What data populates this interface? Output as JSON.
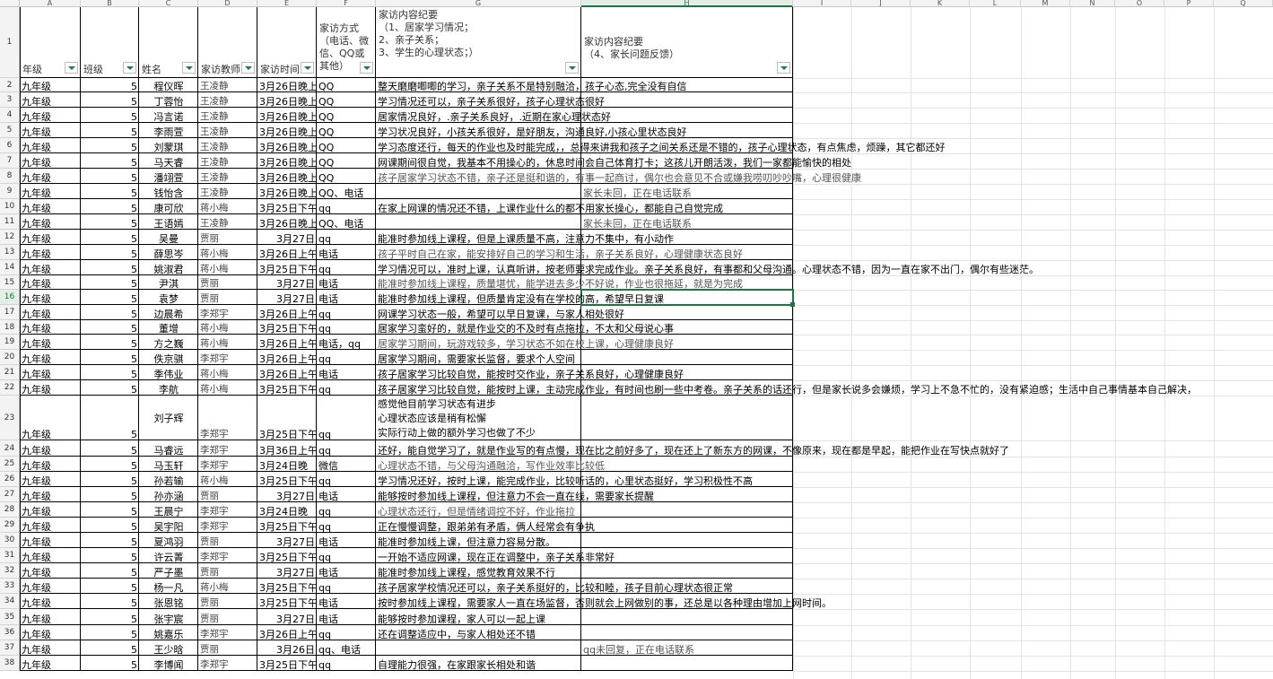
{
  "columns": [
    "A",
    "B",
    "C",
    "D",
    "E",
    "F",
    "G",
    "H",
    "I",
    "J",
    "K",
    "L",
    "M",
    "N",
    "O",
    "P",
    "Q"
  ],
  "selected_cell": "H16",
  "header": {
    "grade": "年级",
    "class": "班级",
    "name": "姓名",
    "teacher": "家访教师",
    "time": "家访时间",
    "method": "家访方式\n（电话、微\n信、QQ或\n其他）",
    "content_g": "家访内容纪要\n（1、居家学习情况；\n2、亲子关系；\n3、学生的心理状态；）",
    "content_h": "家访内容纪要\n（4、家长问题反馈）"
  },
  "rows": [
    {
      "n": "2",
      "grade": "九年级",
      "cls": "5",
      "name": "程仪晖",
      "teacher": "王凌静",
      "time": "3月26日晚上",
      "method": "QQ",
      "g": "整天磨磨唧唧的学习，亲子关系不是特别融洽，孩子心态,完全没有自信",
      "h": ""
    },
    {
      "n": "3",
      "grade": "九年级",
      "cls": "5",
      "name": "丁蓉怡",
      "teacher": "王凌静",
      "time": "3月26日晚上",
      "method": "QQ",
      "g": "学习情况还可以，亲子关系很好，孩子心理状态很好",
      "h": ""
    },
    {
      "n": "4",
      "grade": "九年级",
      "cls": "5",
      "name": "冯言诺",
      "teacher": "王凌静",
      "time": "3月26日晚上",
      "method": "QQ",
      "g": "居家情况良好，.亲子关系良好，.近期在家心理状态好",
      "h": ""
    },
    {
      "n": "5",
      "grade": "九年级",
      "cls": "5",
      "name": "李雨萱",
      "teacher": "王凌静",
      "time": "3月26日晚上",
      "method": "QQ",
      "g": "学习状况良好，小孩关系很好，是好朋友，沟通良好,小孩心里状态良好",
      "h": ""
    },
    {
      "n": "6",
      "grade": "九年级",
      "cls": "5",
      "name": "刘蒙琪",
      "teacher": "王凌静",
      "time": "3月26日晚上",
      "method": "QQ",
      "g": "学习态度还行，每天的作业也及时能完成，，总得来讲我和孩子之间关系还是不错的，孩子心理状态，有点焦虑，烦躁，其它都还好",
      "h": ""
    },
    {
      "n": "7",
      "grade": "九年级",
      "cls": "5",
      "name": "马天睿",
      "teacher": "王凌静",
      "time": "3月26日晚上",
      "method": "QQ",
      "g": "网课期间很自觉，我基本不用操心的，休息时间会自己体育打卡；这孩儿开朗活泼，我们一家都能愉快的相处",
      "h": ""
    },
    {
      "n": "8",
      "grade": "九年级",
      "cls": "5",
      "name": "潘翊萱",
      "teacher": "王凌静",
      "time": "3月26日晚上",
      "method": "QQ",
      "g": "孩子居家学习状态不错，亲子还是挺和谐的，有事一起商讨，偶尔也会意见不合或嫌我唠叨吵吵嘴，心理很健康",
      "h": "",
      "gray": true
    },
    {
      "n": "9",
      "grade": "九年级",
      "cls": "5",
      "name": "钱怡含",
      "teacher": "王凌静",
      "time": "3月26日晚上",
      "method": "QQ、电话",
      "g": "",
      "h": "家长未回，正在电话联系"
    },
    {
      "n": "10",
      "grade": "九年级",
      "cls": "5",
      "name": "康可欣",
      "teacher": "蒋小梅",
      "time": "3月25日下午",
      "method": "qq",
      "g": "在家上网课的情况还不错，上课作业什么的都不用家长操心，都能自己自觉完成",
      "h": ""
    },
    {
      "n": "11",
      "grade": "九年级",
      "cls": "5",
      "name": "王语嫣",
      "teacher": "王凌静",
      "time": "3月26日晚上",
      "method": "QQ、电话",
      "g": "",
      "h": "家长未回，正在电话联系"
    },
    {
      "n": "12",
      "grade": "九年级",
      "cls": "5",
      "name": "吴曼",
      "teacher": "贾丽",
      "time": "3月27日",
      "method": "qq",
      "g": "能准时参加线上课程，但是上课质量不高，注意力不集中，有小动作",
      "h": ""
    },
    {
      "n": "13",
      "grade": "九年级",
      "cls": "5",
      "name": "薛思岑",
      "teacher": "蒋小梅",
      "time": "3月26日上午",
      "method": "电话",
      "g": "孩子平时自己在家，能安排好自己的学习和生活，亲子关系良好，心理健康状态良好",
      "h": "",
      "gray": true
    },
    {
      "n": "14",
      "grade": "九年级",
      "cls": "5",
      "name": "姚淑君",
      "teacher": "蒋小梅",
      "time": "3月25日下午",
      "method": "qq",
      "g": "学习情况可以，准时上课，认真听讲，按老师要求完成作业。亲子关系良好，有事都和父母沟通。心理状态不错，因为一直在家不出门，偶尔有些迷茫。",
      "h": ""
    },
    {
      "n": "15",
      "grade": "九年级",
      "cls": "5",
      "name": "尹淇",
      "teacher": "贾丽",
      "time": "3月27日",
      "method": "电话",
      "g": "能准时参加线上课程，质量堪忧，能学进去多少不好说，作业也很拖延，就是为完成",
      "h": "",
      "gray": true
    },
    {
      "n": "16",
      "grade": "九年级",
      "cls": "5",
      "name": "袁梦",
      "teacher": "贾丽",
      "time": "3月27日",
      "method": "电话",
      "g": "能准时参加线上课程，但质量肯定没有在学校的高，希望早日复课",
      "h": ""
    },
    {
      "n": "17",
      "grade": "九年级",
      "cls": "5",
      "name": "边晨希",
      "teacher": "李郑宇",
      "time": "3月26日上午",
      "method": "qq",
      "g": "网课学习状态一般，希望可以早日复课，与家人相处很好",
      "h": ""
    },
    {
      "n": "18",
      "grade": "九年级",
      "cls": "5",
      "name": "董增",
      "teacher": "蒋小梅",
      "time": "3月25日下午",
      "method": "qq",
      "g": "居家学习蛮好的，就是作业交的不及时有点拖拉，不太和父母说心事",
      "h": ""
    },
    {
      "n": "19",
      "grade": "九年级",
      "cls": "5",
      "name": "方之巍",
      "teacher": "蒋小梅",
      "time": "3月26日上午",
      "method": "电话，qq",
      "g": "居家学习期间，玩游戏较多，学习状态不如在校上课，心理健康良好",
      "h": "",
      "gray": true
    },
    {
      "n": "20",
      "grade": "九年级",
      "cls": "5",
      "name": "佚京骐",
      "teacher": "李郑宇",
      "time": "3月26日上午",
      "method": "qq",
      "g": "居家学习期间，需要家长监督，要求个人空间",
      "h": ""
    },
    {
      "n": "21",
      "grade": "九年级",
      "cls": "5",
      "name": "季伟业",
      "teacher": "蒋小梅",
      "time": "3月26日上午",
      "method": "电话",
      "g": "孩子居家学习比较自觉，能按时交作业，亲子关系良好，心理健康良好",
      "h": ""
    },
    {
      "n": "22",
      "grade": "九年级",
      "cls": "5",
      "name": "李航",
      "teacher": "蒋小梅",
      "time": "3月25日下午",
      "method": "qq",
      "g": "孩子居家学习比较自觉，能按时上课，主动完成作业，有时间也刷一些中考卷。亲子关系的话还行，但是家长说多会嫌烦，学习上不急不忙的，没有紧迫感；生活中自己事情基本自己解决，",
      "h": ""
    },
    {
      "n": "23",
      "grade": "九年级",
      "cls": "5",
      "name": "刘子辉",
      "teacher": "李郑宇",
      "time": "3月25日下午",
      "method": "qq",
      "g": "感觉他目前学习状态有进步\n心理状态应该是稍有松懈\n实际行动上做的额外学习也做了不少",
      "h": ""
    },
    {
      "n": "24",
      "grade": "九年级",
      "cls": "5",
      "name": "马睿远",
      "teacher": "李郑宇",
      "time": "3月36日上午",
      "method": "qq",
      "g": "还好，能自觉学习了，就是作业写的有点慢，现在比之前好多了，现在还上了新东方的网课，不像原来，现在都是早起，能把作业在写快点就好了",
      "h": ""
    },
    {
      "n": "25",
      "grade": "九年级",
      "cls": "5",
      "name": "马玉轩",
      "teacher": "李郑宇",
      "time": "3月24日晚",
      "method": "微信",
      "g": "心理状态不错，与父母沟通融洽，写作业效率比较低",
      "h": "",
      "gray": true
    },
    {
      "n": "26",
      "grade": "九年级",
      "cls": "5",
      "name": "孙若输",
      "teacher": "蒋小梅",
      "time": "3月25日下午",
      "method": "qq",
      "g": "学习情况还好，按时上课，能完成作业，比较听话的，心里状态挺好，学习积极性不高",
      "h": ""
    },
    {
      "n": "27",
      "grade": "九年级",
      "cls": "5",
      "name": "孙亦涵",
      "teacher": "贾丽",
      "time": "3月27日",
      "method": "电话",
      "g": "能够按时参加线上课程，但注意力不会一直在线，需要家长提醒",
      "h": ""
    },
    {
      "n": "28",
      "grade": "九年级",
      "cls": "5",
      "name": "王晨宁",
      "teacher": "李郑宇",
      "time": "3月24日晚",
      "method": "qq",
      "g": "心理状态还行，但是情绪调控不好，作业拖拉",
      "h": "",
      "gray": true
    },
    {
      "n": "29",
      "grade": "九年级",
      "cls": "5",
      "name": "吴宇阳",
      "teacher": "李郑宇",
      "time": "3月25日下午",
      "method": "qq",
      "g": "正在慢慢调整，跟弟弟有矛盾，俩人经常会有争执",
      "h": ""
    },
    {
      "n": "30",
      "grade": "九年级",
      "cls": "5",
      "name": "夏鸿羽",
      "teacher": "贾丽",
      "time": "3月27日",
      "method": "电话",
      "g": "能准时参加线上课，但注意力容易分散。",
      "h": ""
    },
    {
      "n": "31",
      "grade": "九年级",
      "cls": "5",
      "name": "许云菁",
      "teacher": "李郑宇",
      "time": "3月25日下午",
      "method": "qq",
      "g": "一开始不适应网课，现在正在调整中，亲子关系非常好",
      "h": ""
    },
    {
      "n": "32",
      "grade": "九年级",
      "cls": "5",
      "name": "严子墨",
      "teacher": "贾丽",
      "time": "3月27日",
      "method": "电话",
      "g": "能准时参加线上课程，感觉教育效果不行",
      "h": ""
    },
    {
      "n": "33",
      "grade": "九年级",
      "cls": "5",
      "name": "杨一凡",
      "teacher": "蒋小梅",
      "time": "3月25日下午",
      "method": "qq",
      "g": "孩子居家学校情况还可以，亲子关系挺好的，比较和睦，孩子目前心理状态很正常",
      "h": ""
    },
    {
      "n": "34",
      "grade": "九年级",
      "cls": "5",
      "name": "张恩铭",
      "teacher": "贾丽",
      "time": "3月25日下午",
      "method": "电话",
      "g": "按时参加线上课程，需要家人一直在场监督，否则就会上网做别的事，还总是以各种理由增加上网时间。",
      "h": ""
    },
    {
      "n": "35",
      "grade": "九年级",
      "cls": "5",
      "name": "张宇宸",
      "teacher": "贾丽",
      "time": "3月27日",
      "method": "电话",
      "g": "能够按时参加课程，家人可以一起上课",
      "h": ""
    },
    {
      "n": "36",
      "grade": "九年级",
      "cls": "5",
      "name": "姚嘉乐",
      "teacher": "李郑宇",
      "time": "3月26日上午",
      "method": "qq",
      "g": "还在调整适应中，与家人相处还不错",
      "h": ""
    },
    {
      "n": "37",
      "grade": "九年级",
      "cls": "5",
      "name": "王少晗",
      "teacher": "贾丽",
      "time": "3月26日",
      "method": "qq、电话",
      "g": "",
      "h": "qq未回复，正在电话联系"
    },
    {
      "n": "38",
      "grade": "九年级",
      "cls": "5",
      "name": "李博闻",
      "teacher": "李郑宇",
      "time": "3月25日下午",
      "method": "qq",
      "g": "自理能力很强，在家跟家长相处和谐",
      "h": ""
    }
  ]
}
